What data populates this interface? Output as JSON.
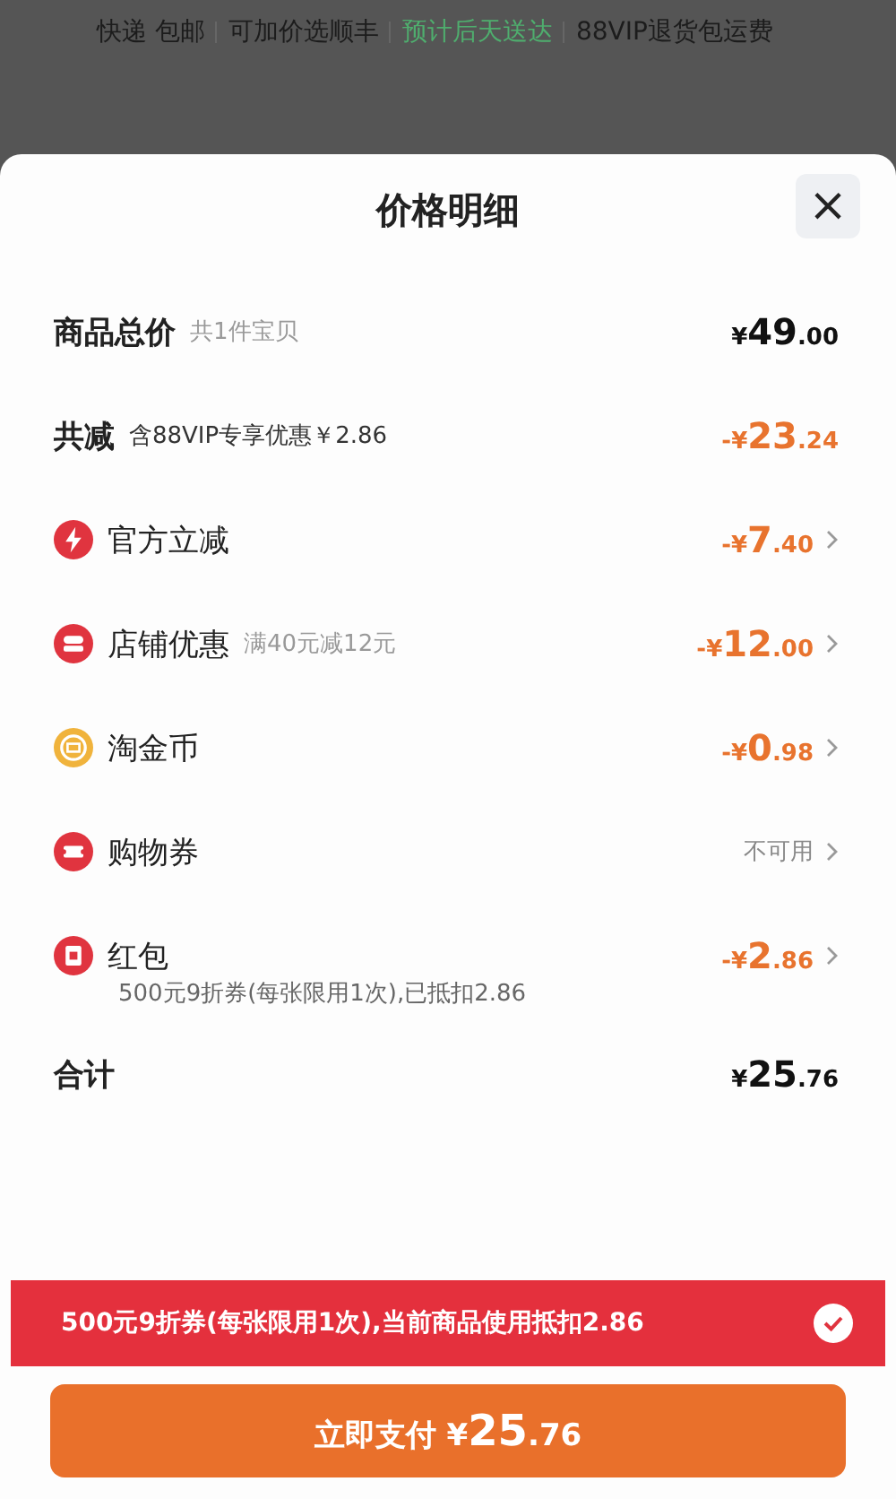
{
  "background": {
    "shipping": [
      {
        "text": "快递 包邮",
        "highlight": false
      },
      {
        "text": "可加价选顺丰",
        "highlight": false
      },
      {
        "text": "预计后天送达",
        "highlight": true
      },
      {
        "text": "88VIP退货包运费",
        "highlight": false
      }
    ]
  },
  "sheet": {
    "title": "价格明细",
    "close": "×",
    "rows": [
      {
        "kind": "summary",
        "label": "商品总价",
        "note": "共1件宝贝",
        "price": {
          "prefix": "¥",
          "int": "49",
          "dec": ".00"
        },
        "discount": false,
        "arrow": false
      },
      {
        "kind": "summary",
        "label": "共减",
        "note": "含88VIP专享优惠￥2.86",
        "price": {
          "prefix": "-¥",
          "int": "23",
          "dec": ".24"
        },
        "discount": true,
        "arrow": false
      },
      {
        "kind": "item",
        "label": "官方立减",
        "price": {
          "prefix": "-¥",
          "int": "7",
          "dec": ".40"
        },
        "discount": true,
        "arrow": true
      },
      {
        "kind": "item",
        "label": "店铺优惠",
        "note": "满40元减12元",
        "price": {
          "prefix": "-¥",
          "int": "12",
          "dec": ".00"
        },
        "discount": true,
        "arrow": true
      },
      {
        "kind": "item",
        "label": "淘金币",
        "price": {
          "prefix": "-¥",
          "int": "0",
          "dec": ".98"
        },
        "discount": true,
        "arrow": true
      },
      {
        "kind": "item",
        "label": "购物券",
        "status": "不可用",
        "arrow": true
      },
      {
        "kind": "item",
        "label": "红包",
        "price": {
          "prefix": "-¥",
          "int": "2",
          "dec": ".86"
        },
        "discount": true,
        "arrow": true,
        "detail": "500元9折券(每张限用1次),已抵扣2.86"
      },
      {
        "kind": "summary",
        "label": "合计",
        "price": {
          "prefix": "¥",
          "int": "25",
          "dec": ".76"
        },
        "discount": false,
        "arrow": false
      }
    ],
    "banner": {
      "text": "500元9折券(每张限用1次),当前商品使用抵扣2.86",
      "checked": true
    },
    "pay": {
      "label": "立即支付",
      "price": {
        "prefix": "¥",
        "int": "25",
        "dec": ".76"
      }
    }
  }
}
